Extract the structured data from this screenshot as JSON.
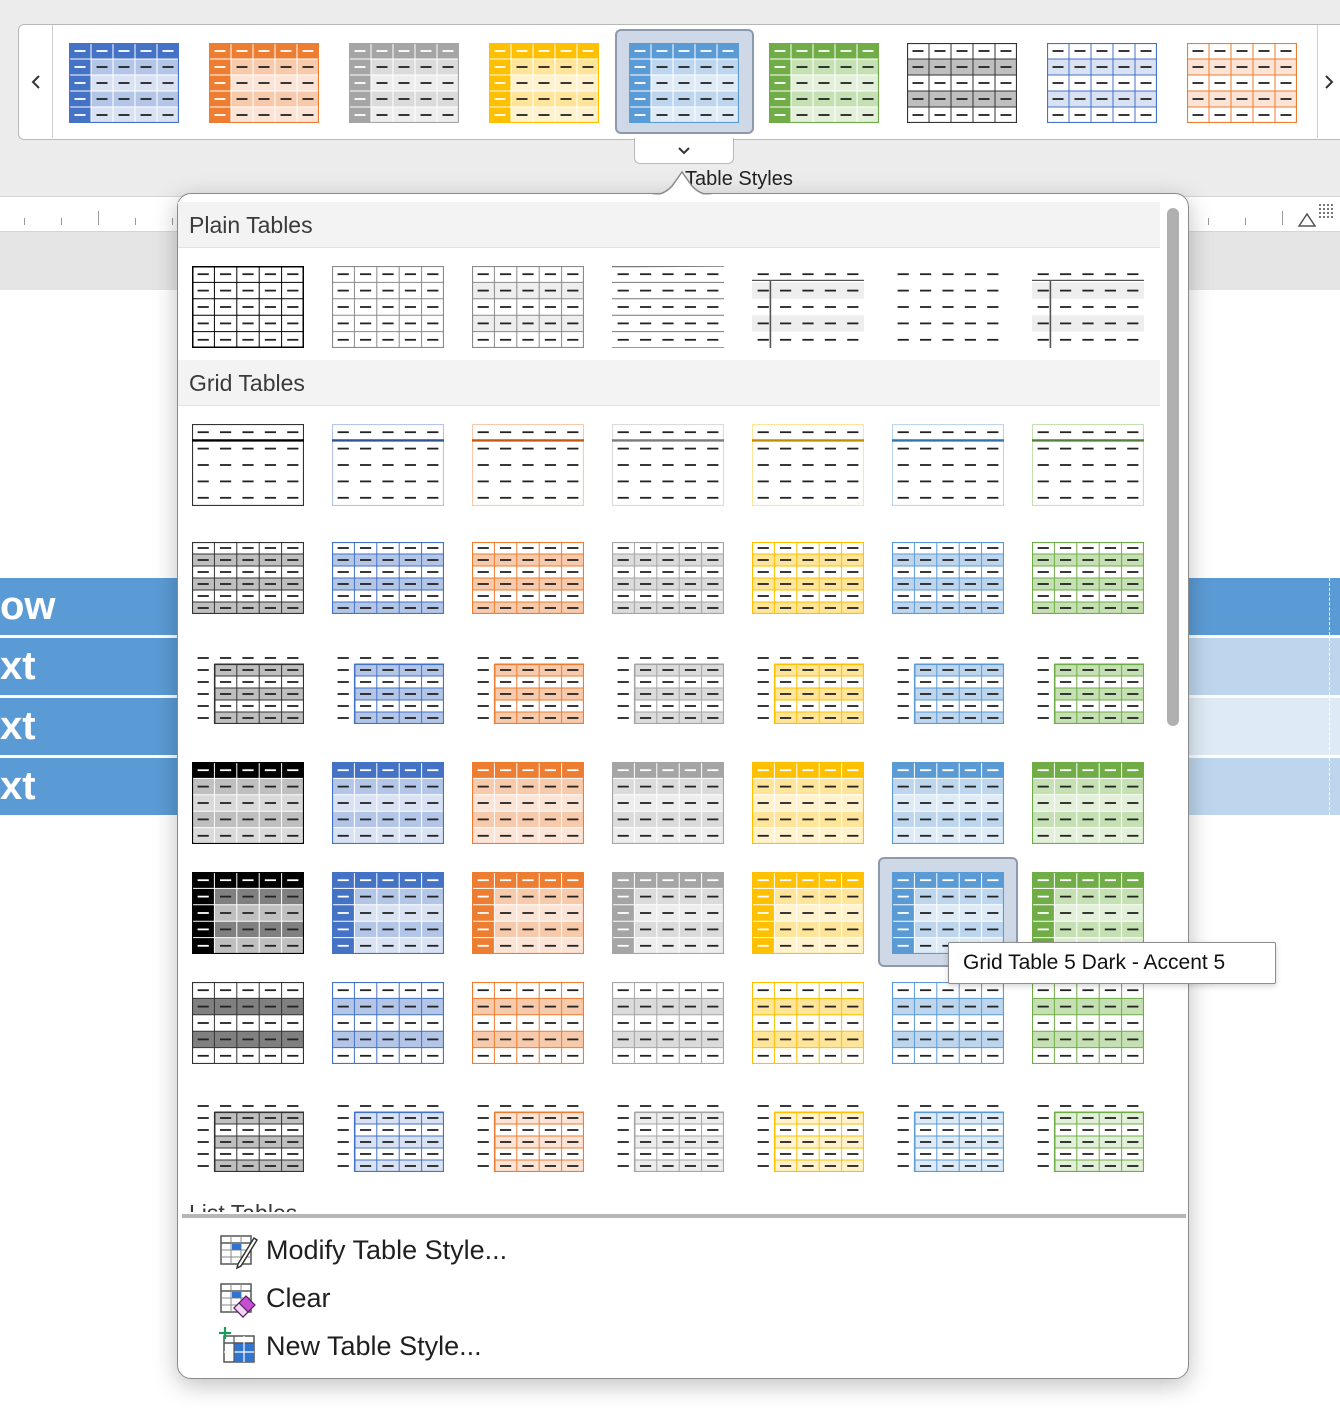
{
  "gallery": {
    "label": "Table Styles",
    "thumbnails": [
      {
        "style": "Grid Table 5 Dark - Accent 1",
        "accent": "#4472c4",
        "light": "#d9e2f3",
        "mid": "#b4c6e7"
      },
      {
        "style": "Grid Table 5 Dark - Accent 2",
        "accent": "#ed7d31",
        "light": "#fbe4d5",
        "mid": "#f7caac"
      },
      {
        "style": "Grid Table 5 Dark - Accent 3",
        "accent": "#a5a5a5",
        "light": "#ededed",
        "mid": "#dbdbdb"
      },
      {
        "style": "Grid Table 5 Dark - Accent 4",
        "accent": "#ffc000",
        "light": "#fff2cc",
        "mid": "#ffe599"
      },
      {
        "style": "Grid Table 5 Dark - Accent 5",
        "accent": "#5b9bd5",
        "light": "#deebf6",
        "mid": "#bdd6ee",
        "selected": true
      },
      {
        "style": "Grid Table 5 Dark - Accent 6",
        "accent": "#70ad47",
        "light": "#e2efd9",
        "mid": "#c5e0b3"
      },
      {
        "style": "Grid Table 6 Colorful",
        "accent": "#000000",
        "light": "#ffffff",
        "mid": "#bfbfbf"
      },
      {
        "style": "Grid Table 6 Colorful - Accent 1",
        "accent": "#4472c4",
        "light": "#ffffff",
        "mid": "#d9e2f3"
      },
      {
        "style": "Grid Table 6 Colorful - Accent 2",
        "accent": "#ed7d31",
        "light": "#ffffff",
        "mid": "#fbe4d5"
      }
    ]
  },
  "panel": {
    "sections": [
      {
        "title": "Plain Tables"
      },
      {
        "title": "Grid Tables"
      },
      {
        "title": "List Tables"
      }
    ],
    "menu": [
      {
        "label": "Modify Table Style...",
        "icon": "modify-table-style-icon"
      },
      {
        "label": "Clear",
        "icon": "clear-table-style-icon"
      },
      {
        "label": "New Table Style...",
        "icon": "new-table-style-icon"
      }
    ],
    "tooltip": "Grid Table 5 Dark - Accent 5"
  },
  "document": {
    "row_texts": [
      "ow",
      "xt",
      "xt",
      "xt"
    ]
  },
  "colors": {
    "accents": [
      "#000000",
      "#4472c4",
      "#ed7d31",
      "#a5a5a5",
      "#ffc000",
      "#5b9bd5",
      "#70ad47"
    ],
    "lights": [
      "#bfbfbf",
      "#d9e2f3",
      "#fbe4d5",
      "#ededed",
      "#fff2cc",
      "#deebf6",
      "#e2efd9"
    ],
    "mids": [
      "#808080",
      "#b4c6e7",
      "#f7caac",
      "#dbdbdb",
      "#ffe599",
      "#bdd6ee",
      "#c5e0b3"
    ],
    "darks": [
      "#000000",
      "#2f5496",
      "#c45911",
      "#7b7b7b",
      "#bf8f00",
      "#2e74b5",
      "#538135"
    ],
    "selection": "#cfd8e6"
  }
}
